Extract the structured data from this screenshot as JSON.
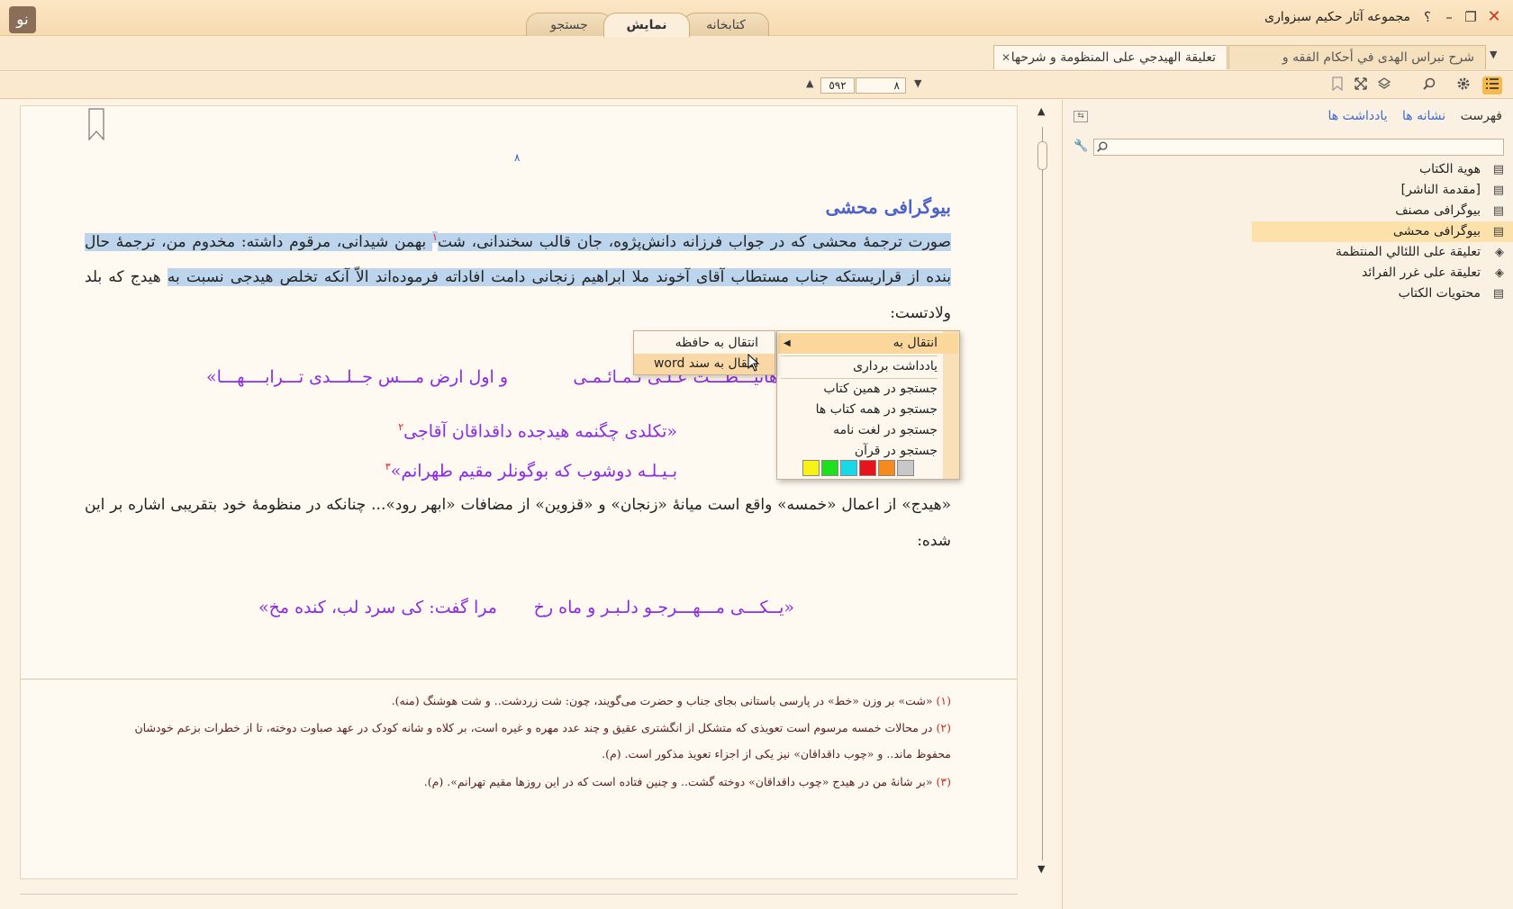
{
  "window": {
    "title": "مجموعه آثار حکیم سبزواری",
    "logo_text": "نو",
    "controls": {
      "help": "؟",
      "minimize": "–",
      "maximize": "❐",
      "close": "✕"
    }
  },
  "main_tabs": [
    {
      "label": "کتابخانه"
    },
    {
      "label": "نمایش",
      "active": true
    },
    {
      "label": "جستجو"
    }
  ],
  "doc_tabs": [
    {
      "label": "تعليقة الهيدجي على المنظومة و شرحها",
      "active": true
    },
    {
      "label": "شرح نبراس الهدى في أحكام الفقه و أسرارها",
      "active": false
    }
  ],
  "doc_tab_close": "✕",
  "doc_tab_dropdown": "▼",
  "toolbar": {
    "icons": [
      "list-icon",
      "gear-icon",
      "search-icon",
      "layers-icon",
      "expand-icon",
      "bookmark-icon"
    ],
    "page_current": "٨",
    "page_total": "٥٩٢",
    "prev_arrow": "▲",
    "next_arrow": "▼"
  },
  "document": {
    "page_number": "٨",
    "heading": "بیوگرافی محشی",
    "para1": {
      "highlighted": "صورت ترجمۀ محشی که در جواب فرزانه دانش‌پژوه، جان قالب سخندانی، شت",
      "footnote_ref": "١",
      "highlighted_2": " بهمن شیدانی، مرقوم داشته: مخدوم من، ترجمۀ حال بنده از قراریستکه جناب مستطاب آقای آخوند ملا ابراهیم زنجانی دامت افاداته فرموده‌اند الاّ آنکه تخلص هیدجی نسبت به",
      "rest": " هیدج که بلد ولادتست:"
    },
    "verse1_right": "هانيـــطـــت عـلـى تـمـائـمـى",
    "verse1_left": "و اول ارض مـــس جــلـــدى تـــرابــــهـــا»",
    "verse2": "«تکلدی چگنمه هیدجده داقداقان آقاجی",
    "verse2_ref": "٢",
    "verse3": "بـيـلـه دوشوب که بوگونلر مقیم طهرانم»",
    "verse3_ref": "٣",
    "para2": "«هیدج» از اعمال «خمسه» واقع است میانۀ «زنجان» و «قزوین» از مضافات «ابهر رود»... چنانکه در منظومۀ خود بتقریبی اشاره بر این شده:",
    "verse4_right": "«يــکـــی مـــهـــرجـو دلـبـر و ماه رخ",
    "verse4_left": "مرا گفت: کی سرد لب، کنده مخ»",
    "footnotes": [
      {
        "num": "(١)",
        "text": "«شت» بر وزن «خط» در پارسی باستانی بجای جناب و حضرت می‌گویند، چون: شت زردشت.. و شت هوشنگ (منه)."
      },
      {
        "num": "(٢)",
        "text": "در محالات خمسه مرسوم است تعویذی که متشکل از انگشتری عقیق و چند عدد مهره و غیره است، بر کلاه و شانه کودک در عهد صباوت دوخته، تا از خطرات بزعم خودشان محفوظ ماند.. و «چوب داقداقان» نیز یکی از اجزاء تعویذ مذکور است. (م)."
      },
      {
        "num": "(٣)",
        "text": "«بر شانۀ من در هیدج «چوب داقداقان» دوخته گشت.. و چنین فتاده است که در این روزها مقیم تهرانم». (م)."
      }
    ]
  },
  "sidebar": {
    "tabs": [
      "فهرست",
      "نشانه ها",
      "یادداشت ها"
    ],
    "search_placeholder": "",
    "toc": [
      {
        "label": "هوية الكتاب",
        "icon": "page-icon"
      },
      {
        "label": "[مقدمة الناشر]",
        "icon": "page-icon"
      },
      {
        "label": "بیوگرافی مصنف",
        "icon": "page-icon"
      },
      {
        "label": "بیوگرافی محشی",
        "icon": "page-icon",
        "selected": true
      },
      {
        "label": "تعليقة على اللئالي المنتظمة",
        "icon": "book-icon"
      },
      {
        "label": "تعليقة على غرر الفرائد",
        "icon": "book-icon"
      },
      {
        "label": "محتويات الكتاب",
        "icon": "page-icon"
      }
    ]
  },
  "context_menu": {
    "items": [
      {
        "label": "انتقال به",
        "submenu": true
      },
      {
        "label": "یادداشت برداری"
      },
      {
        "label": "جستجو در همین کتاب"
      },
      {
        "label": "جستجو در همه کتاب ها"
      },
      {
        "label": "جستجو در لغت نامه"
      },
      {
        "label": "جستجو در قرآن"
      }
    ],
    "colors": [
      "#c8c8c8",
      "#f58a1f",
      "#e8141b",
      "#19d9e8",
      "#1fe01f",
      "#f6f316"
    ],
    "submenu": [
      {
        "label": "انتقال به حافظه"
      },
      {
        "label": "انتقال به سند word"
      }
    ]
  }
}
